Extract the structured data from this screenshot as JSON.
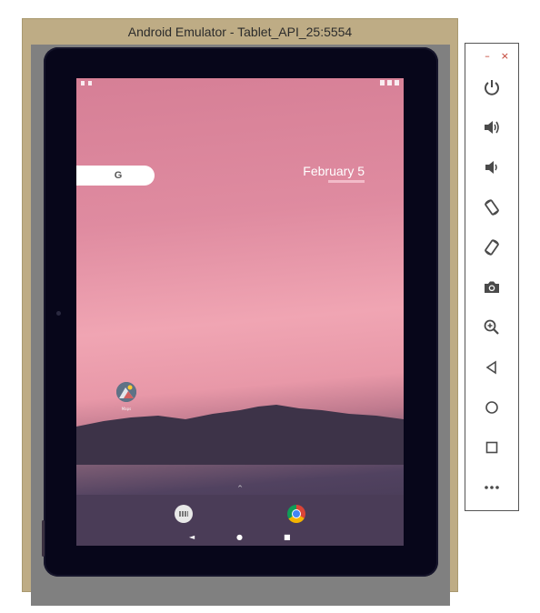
{
  "window": {
    "title": "Android Emulator - Tablet_API_25:5554"
  },
  "screen": {
    "search": {
      "logo": "G"
    },
    "date": {
      "label": "February 5"
    },
    "home_app": {
      "label": "Maps"
    },
    "dock": {
      "apps": [
        {
          "icon": "keyboard-icon"
        },
        {
          "icon": "chrome-icon"
        }
      ]
    },
    "nav": {
      "back": "◄",
      "home": "●",
      "recents": "■"
    }
  },
  "toolbar": {
    "minimize": "–",
    "close": "×",
    "buttons": [
      {
        "icon": "power-icon"
      },
      {
        "icon": "volume-up-icon"
      },
      {
        "icon": "volume-down-icon"
      },
      {
        "icon": "rotate-left-icon"
      },
      {
        "icon": "rotate-right-icon"
      },
      {
        "icon": "camera-icon"
      },
      {
        "icon": "zoom-icon"
      },
      {
        "icon": "back-icon"
      },
      {
        "icon": "home-icon"
      },
      {
        "icon": "overview-icon"
      },
      {
        "icon": "more-icon"
      }
    ]
  },
  "colors": {
    "window_frame": "#beac85",
    "toolbar_icon": "#4a4a4a",
    "close_red": "#c0392b"
  }
}
